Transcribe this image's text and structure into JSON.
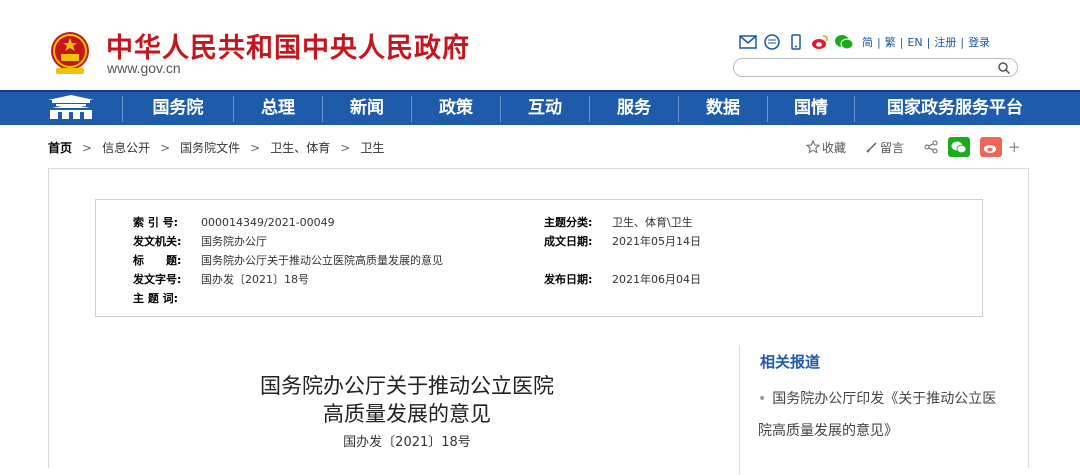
{
  "header": {
    "site_title": "中华人民共和国中央人民政府",
    "site_url": "www.gov.cn",
    "links": [
      "简",
      "繁",
      "EN",
      "注册",
      "登录"
    ],
    "separator": "|",
    "icons": [
      "mail-icon",
      "message-icon",
      "mobile-icon",
      "weibo-icon",
      "wechat-icon"
    ],
    "search_placeholder": ""
  },
  "nav": {
    "items": [
      "国务院",
      "总理",
      "新闻",
      "政策",
      "互动",
      "服务",
      "数据",
      "国情",
      "国家政务服务平台"
    ]
  },
  "breadcrumb": {
    "items": [
      "首页",
      "信息公开",
      "国务院文件",
      "卫生、体育",
      "卫生"
    ],
    "separator": ">"
  },
  "share": {
    "favorite": "收藏",
    "comment": "留言",
    "more": "+"
  },
  "meta": {
    "index_label": "索 引 号:",
    "index_value": "000014349/2021-00049",
    "category_label": "主题分类:",
    "category_value": "卫生、体育\\卫生",
    "issuer_label": "发文机关:",
    "issuer_value": "国务院办公厅",
    "date_made_label": "成文日期:",
    "date_made_value": "2021年05月14日",
    "title_label": "标　　题:",
    "title_value": "国务院办公厅关于推动公立医院高质量发展的意见",
    "doc_no_label": "发文字号:",
    "doc_no_value": "国办发〔2021〕18号",
    "publish_label": "发布日期:",
    "publish_value": "2021年06月04日",
    "keywords_label": "主 题 词:",
    "keywords_value": ""
  },
  "document": {
    "title_line1": "国务院办公厅关于推动公立医院",
    "title_line2": "高质量发展的意见",
    "number": "国办发〔2021〕18号"
  },
  "related": {
    "heading": "相关报道",
    "items": [
      "国务院办公厅印发《关于推动公立医院高质量发展的意见》"
    ]
  },
  "colors": {
    "brand_red": "#c4161c",
    "nav_blue": "#1f5bab",
    "link_blue": "#1a57a8"
  }
}
